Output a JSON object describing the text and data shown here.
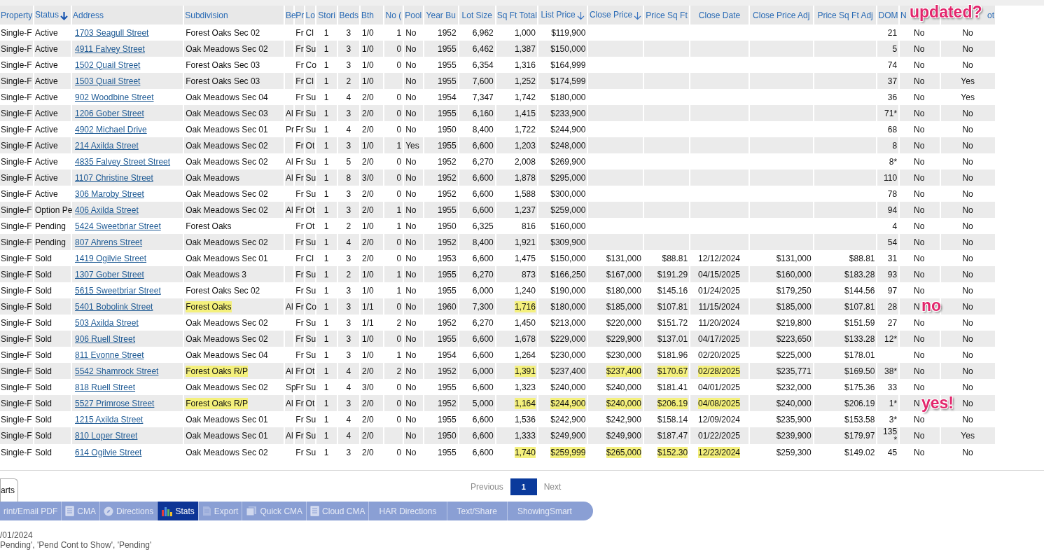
{
  "table": {
    "columns": [
      {
        "label": "Property",
        "sorted": false
      },
      {
        "label": "Status",
        "sorted": true
      },
      {
        "label": "Address",
        "sorted": false
      },
      {
        "label": "Subdivision",
        "sorted": false
      },
      {
        "label": "Be",
        "sorted": false
      },
      {
        "label": "Pr",
        "sorted": false
      },
      {
        "label": "Lo",
        "sorted": false
      },
      {
        "label": "Stori",
        "sorted": false
      },
      {
        "label": "Beds",
        "sorted": false
      },
      {
        "label": "Bth",
        "sorted": false
      },
      {
        "label": "No (",
        "sorted": false
      },
      {
        "label": "Pool",
        "sorted": false
      },
      {
        "label": "Year Bu",
        "sorted": false
      },
      {
        "label": "Lot Size",
        "sorted": false
      },
      {
        "label": "Sq Ft Total",
        "sorted": false
      },
      {
        "label": "List Price",
        "sorted": true
      },
      {
        "label": "Close Price",
        "sorted": true
      },
      {
        "label": "Price Sq Ft",
        "sorted": false
      },
      {
        "label": "Close Date",
        "sorted": false
      },
      {
        "label": "Close Price Adj",
        "sorted": false
      },
      {
        "label": "Price Sq Ft Adj",
        "sorted": false
      },
      {
        "label": "DOM",
        "sorted": false
      },
      {
        "label": "N",
        "sorted": false
      },
      {
        "label": "ot",
        "sorted": false
      }
    ],
    "rows": [
      {
        "cells": [
          "Single-F",
          "Active",
          "1703 Seagull Street",
          "Forest Oaks Sec 02",
          null,
          "Fr",
          "Cl",
          "1",
          "3",
          "1/0",
          "1",
          "No",
          "1952",
          "6,962",
          "1,000",
          "$119,900",
          null,
          null,
          null,
          null,
          null,
          "21",
          "No",
          "No"
        ]
      },
      {
        "cells": [
          "Single-F",
          "Active",
          "4911 Falvey Street",
          "Oak Meadows Sec 02",
          null,
          "Fr",
          "Su",
          "1",
          "3",
          "1/0",
          "0",
          "No",
          "1955",
          "6,462",
          "1,387",
          "$150,000",
          null,
          null,
          null,
          null,
          null,
          "5",
          "No",
          "No"
        ]
      },
      {
        "cells": [
          "Single-F",
          "Active",
          "1502 Quail Street",
          "Forest Oaks Sec 03",
          null,
          "Fr",
          "Co",
          "1",
          "3",
          "1/0",
          "0",
          "No",
          "1955",
          "6,354",
          "1,316",
          "$164,999",
          null,
          null,
          null,
          null,
          null,
          "74",
          "No",
          "No"
        ]
      },
      {
        "cells": [
          "Single-F",
          "Active",
          "1503 Quail Street",
          "Forest Oaks Sec 03",
          null,
          "Fr",
          "Cl",
          "1",
          "2",
          "1/0",
          null,
          "No",
          "1955",
          "7,600",
          "1,252",
          "$174,599",
          null,
          null,
          null,
          null,
          null,
          "37",
          "No",
          "Yes"
        ]
      },
      {
        "cells": [
          "Single-F",
          "Active",
          "902 Woodbine Street",
          "Oak Meadows Sec 04",
          null,
          "Fr",
          "Su",
          "1",
          "4",
          "2/0",
          "0",
          "No",
          "1954",
          "7,347",
          "1,742",
          "$180,000",
          null,
          null,
          null,
          null,
          null,
          "36",
          "No",
          "Yes"
        ]
      },
      {
        "cells": [
          "Single-F",
          "Active",
          "1206 Gober Street",
          "Oak Meadows Sec 03",
          "Al",
          "Fr",
          "Su",
          "1",
          "3",
          "2/0",
          "0",
          "No",
          "1955",
          "6,160",
          "1,415",
          "$233,900",
          null,
          null,
          null,
          null,
          null,
          "71*",
          "No",
          "No"
        ]
      },
      {
        "cells": [
          "Single-F",
          "Active",
          "4902 Michael Drive",
          "Oak Meadows Sec 01",
          "Pr",
          "Fr",
          "Su",
          "1",
          "4",
          "2/0",
          "0",
          "No",
          "1950",
          "8,400",
          "1,722",
          "$244,900",
          null,
          null,
          null,
          null,
          null,
          "68",
          "No",
          "No"
        ]
      },
      {
        "cells": [
          "Single-F",
          "Active",
          "214 Axilda Street",
          "Oak Meadows Sec 02",
          null,
          "Fr",
          "Ot",
          "1",
          "3",
          "1/0",
          "1",
          "Yes",
          "1955",
          "6,600",
          "1,203",
          "$248,000",
          null,
          null,
          null,
          null,
          null,
          "8",
          "No",
          "No"
        ]
      },
      {
        "cells": [
          "Single-F",
          "Active",
          "4835 Falvey Street Street",
          "Oak Meadows Sec 02",
          "Al",
          "Fr",
          "Su",
          "1",
          "5",
          "2/0",
          "0",
          "No",
          "1952",
          "6,270",
          "2,008",
          "$269,900",
          null,
          null,
          null,
          null,
          null,
          "8*",
          "No",
          "No"
        ]
      },
      {
        "cells": [
          "Single-F",
          "Active",
          "1107 Christine Street",
          "Oak Meadows",
          "Al",
          "Fr",
          "Su",
          "1",
          "8",
          "3/0",
          "0",
          "No",
          "1952",
          "6,600",
          "1,878",
          "$295,000",
          null,
          null,
          null,
          null,
          null,
          "110",
          "No",
          "No"
        ]
      },
      {
        "cells": [
          "Single-F",
          "Active",
          "306 Maroby Street",
          "Oak Meadows Sec 02",
          null,
          "Fr",
          "Su",
          "1",
          "3",
          "2/0",
          "0",
          "No",
          "1952",
          "6,600",
          "1,588",
          "$300,000",
          null,
          null,
          null,
          null,
          null,
          "78",
          "No",
          "No"
        ]
      },
      {
        "cells": [
          "Single-F",
          "Option Pe",
          "406 Axilda Street",
          "Oak Meadows Sec 02",
          "Al",
          "Fr",
          "Ot",
          "1",
          "3",
          "2/0",
          "1",
          "No",
          "1955",
          "6,600",
          "1,237",
          "$259,000",
          null,
          null,
          null,
          null,
          null,
          "94",
          "No",
          "No"
        ]
      },
      {
        "cells": [
          "Single-F",
          "Pending",
          "5424 Sweetbriar Street",
          "Forest Oaks",
          null,
          "Fr",
          "Ot",
          "1",
          "2",
          "1/0",
          "1",
          "No",
          "1950",
          "6,325",
          "816",
          "$160,000",
          null,
          null,
          null,
          null,
          null,
          "4",
          "No",
          "No"
        ]
      },
      {
        "cells": [
          "Single-F",
          "Pending",
          "807 Ahrens Street",
          "Oak Meadows Sec 02",
          null,
          "Fr",
          "Su",
          "1",
          "4",
          "2/0",
          "0",
          "No",
          "1952",
          "8,400",
          "1,921",
          "$309,900",
          null,
          null,
          null,
          null,
          null,
          "54",
          "No",
          "No"
        ]
      },
      {
        "cells": [
          "Single-F",
          "Sold",
          "1419 Ogilvie Street",
          "Oak Meadows Sec 01",
          null,
          "Fr",
          "Cl",
          "1",
          "3",
          "2/0",
          "0",
          "No",
          "1953",
          "6,600",
          "1,475",
          "$150,000",
          "$131,000",
          "$88.81",
          "12/12/2024",
          "$131,000",
          "$88.81",
          "31",
          "No",
          "No"
        ]
      },
      {
        "cells": [
          "Single-F",
          "Sold",
          "1307 Gober Street",
          "Oak Meadows 3",
          null,
          "Fr",
          "Su",
          "1",
          "2",
          "1/0",
          "1",
          "No",
          "1955",
          "6,270",
          "873",
          "$166,250",
          "$167,000",
          "$191.29",
          "04/15/2025",
          "$160,000",
          "$183.28",
          "93",
          "No",
          "No"
        ]
      },
      {
        "cells": [
          "Single-F",
          "Sold",
          "5615 Sweetbriar Street",
          "Forest Oaks Sec 02",
          null,
          "Fr",
          "Su",
          "1",
          "3",
          "1/0",
          "1",
          "No",
          "1955",
          "6,000",
          "1,240",
          "$190,000",
          "$180,000",
          "$145.16",
          "01/24/2025",
          "$179,250",
          "$144.56",
          "97",
          "No",
          "No"
        ]
      },
      {
        "cells": [
          "Single-F",
          "Sold",
          "5401 Bobolink Street",
          {
            "text": "Forest Oaks",
            "highlighted": true
          },
          "Al",
          "Fr",
          "Co",
          "1",
          "3",
          "1/1",
          "0",
          "No",
          "1960",
          "7,300",
          {
            "text": "1,716",
            "highlighted": true
          },
          "$180,000",
          "$185,000",
          "$107.81",
          "11/15/2024",
          "$185,000",
          "$107.81",
          "28",
          "N",
          "No"
        ]
      },
      {
        "cells": [
          "Single-F",
          "Sold",
          "503 Axilda Street",
          "Oak Meadows Sec 02",
          null,
          "Fr",
          "Su",
          "1",
          "3",
          "1/1",
          "2",
          "No",
          "1952",
          "6,270",
          "1,450",
          "$213,000",
          "$220,000",
          "$151.72",
          "11/20/2024",
          "$219,800",
          "$151.59",
          "27",
          "No",
          "No"
        ]
      },
      {
        "cells": [
          "Single-F",
          "Sold",
          "906 Ruell Street",
          "Oak Meadows Sec 02",
          null,
          "Fr",
          "Su",
          "1",
          "3",
          "1/0",
          "0",
          "No",
          "1955",
          "6,600",
          "1,678",
          "$229,000",
          "$229,900",
          "$137.01",
          "04/17/2025",
          "$223,650",
          "$133.28",
          "12*",
          "No",
          "No"
        ]
      },
      {
        "cells": [
          "Single-F",
          "Sold",
          "811 Evonne Street",
          "Oak Meadows Sec 04",
          null,
          "Fr",
          "Su",
          "1",
          "3",
          "1/0",
          "1",
          "No",
          "1954",
          "6,600",
          "1,264",
          "$230,000",
          "$230,000",
          "$181.96",
          "02/20/2025",
          "$225,000",
          "$178.01",
          null,
          "No",
          "No"
        ]
      },
      {
        "cells": [
          "Single-F",
          "Sold",
          "5542 Shamrock Street",
          {
            "text": "Forest Oaks R/P",
            "highlighted": true
          },
          "Al",
          "Fr",
          "Ot",
          "1",
          "4",
          "2/0",
          "2",
          "No",
          "1952",
          "6,000",
          {
            "text": "1,391",
            "highlighted": true
          },
          "$237,400",
          {
            "text": "$237,400",
            "highlighted": true
          },
          {
            "text": "$170.67",
            "highlighted": true
          },
          {
            "text": "02/28/2025",
            "highlighted": true
          },
          "$235,771",
          "$169.50",
          "38*",
          "No",
          "No"
        ]
      },
      {
        "cells": [
          "Single-F",
          "Sold",
          "818 Ruell Street",
          "Oak Meadows Sec 02",
          "Sp",
          "Fr",
          "Su",
          "1",
          "4",
          "3/0",
          "0",
          "No",
          "1955",
          "6,600",
          "1,323",
          "$240,000",
          "$240,000",
          "$181.41",
          "04/01/2025",
          "$232,000",
          "$175.36",
          "33",
          "No",
          "No"
        ]
      },
      {
        "cells": [
          "Single-F",
          "Sold",
          "5527 Primrose Street",
          {
            "text": "Forest Oaks R/P",
            "highlighted": true
          },
          "Al",
          "Fr",
          "Ot",
          "1",
          "3",
          "2/0",
          "0",
          "No",
          "1952",
          "5,000",
          {
            "text": "1,164",
            "highlighted": true
          },
          {
            "text": "$244,900",
            "highlighted": true
          },
          {
            "text": "$240,000",
            "highlighted": true
          },
          {
            "text": "$206.19",
            "highlighted": true
          },
          {
            "text": "04/08/2025",
            "highlighted": true
          },
          "$240,000",
          "$206.19",
          "1*",
          "N",
          "No"
        ]
      },
      {
        "cells": [
          "Single-F",
          "Sold",
          "1215 Axilda Street",
          "Oak Meadows Sec 01",
          null,
          "Fr",
          "Su",
          "1",
          "4",
          "2/0",
          "0",
          "No",
          "1955",
          "6,600",
          "1,536",
          "$242,900",
          "$242,900",
          "$158.14",
          "12/09/2024",
          "$235,900",
          "$153.58",
          "3*",
          "No",
          "No"
        ]
      },
      {
        "cells": [
          "Single-F",
          "Sold",
          "810 Loper Street",
          "Oak Meadows Sec 01",
          "Al",
          "Fr",
          "Su",
          "1",
          "4",
          "2/0",
          null,
          "No",
          "1950",
          "6,600",
          "1,333",
          "$249,900",
          "$249,900",
          "$187.47",
          "01/22/2025",
          "$239,900",
          "$179.97",
          "135 *",
          "No",
          "Yes"
        ]
      },
      {
        "cells": [
          "Single-F",
          "Sold",
          "614 Ogilvie Street",
          "Oak Meadows Sec 02",
          null,
          "Fr",
          "Su",
          "1",
          "3",
          "2/0",
          "0",
          "No",
          "1955",
          "6,600",
          {
            "text": "1,740",
            "highlighted": true
          },
          {
            "text": "$259,999",
            "highlighted": true
          },
          {
            "text": "$265,000",
            "highlighted": true
          },
          {
            "text": "$152.30",
            "highlighted": true
          },
          {
            "text": "12/23/2024",
            "highlighted": true
          },
          "$259,300",
          "$149.02",
          "45",
          "No",
          "No"
        ]
      }
    ]
  },
  "annotations": [
    {
      "text": "updated?"
    },
    {
      "text": "no"
    },
    {
      "text": "yes!"
    }
  ],
  "tab": {
    "label": "arts"
  },
  "pagination": {
    "previous": "Previous",
    "page": "1",
    "next": "Next"
  },
  "toolbar": [
    {
      "label": "rint/Email PDF",
      "kind": "plain",
      "selected": false
    },
    {
      "label": "CMA",
      "kind": "notebook",
      "selected": false
    },
    {
      "label": "Directions",
      "kind": "compass",
      "selected": false
    },
    {
      "label": "Stats",
      "kind": "chart",
      "selected": true
    },
    {
      "label": "Export",
      "kind": "document",
      "selected": false
    },
    {
      "label": "Quick CMA",
      "kind": "stack",
      "selected": false
    },
    {
      "label": "Cloud CMA",
      "kind": "notebook",
      "selected": false
    },
    {
      "label": "HAR Directions",
      "kind": "plain",
      "selected": false
    },
    {
      "label": "Text/Share",
      "kind": "plain",
      "selected": false
    },
    {
      "label": "ShowingSmart",
      "kind": "plain",
      "selected": false
    }
  ],
  "footer_lines": [
    "/01/2024",
    "Pending', 'Pend Cont to Show', 'Pending'"
  ]
}
